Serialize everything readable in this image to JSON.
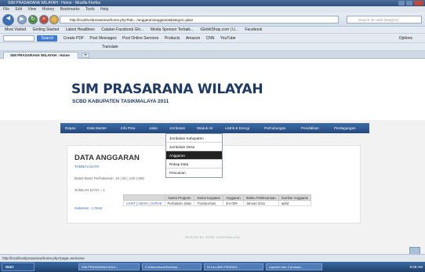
{
  "window": {
    "title": "SIM PRASARANA WILAYAH : Home - Mozilla Firefox"
  },
  "menubar": [
    "File",
    "Edit",
    "View",
    "History",
    "Bookmarks",
    "Tools",
    "Help"
  ],
  "navigation": {
    "url": "http://localhost/prasarana/home.php?hal=../anggaran/anggaran&kategori=jalan",
    "search_placeholder": "Search the web (Babylon)"
  },
  "bookmarks": [
    "Most Visited",
    "Getting Started",
    "Latest Headlines",
    "Catatan Facebook Glo...",
    "Media Sponsor Terbaik...",
    "iGlobitShop.com | U...",
    "Facebook"
  ],
  "toolbar2": {
    "search_button": "Search",
    "items": [
      "Create PDF",
      "Post Messages",
      "Post Online Services",
      "Products",
      "Amazon",
      "CNN",
      "YouTube"
    ],
    "options": "Options"
  },
  "toolbar3": {
    "translate": "Translate"
  },
  "tab": {
    "label": "SIM PRASARANA WILAYAH : Home",
    "new_tab": "+"
  },
  "site": {
    "title": "SIM PRASARANA WILAYAH",
    "subtitle": "SCBD KABUPATEN TASIKMALAYA 2011"
  },
  "nav_items": [
    "Depan",
    "Data Master",
    "Info Peta",
    "Jalan",
    "Jembatan",
    "Waduk Air",
    "Listrik & Energi",
    "Perhubungan",
    "Pendidikan",
    "Perdagangan"
  ],
  "dropdown": [
    "Jembatan Kabupaten",
    "Jembatan Desa",
    "Anggaran",
    "Rekap Data",
    "Pencarian"
  ],
  "panel": {
    "title": "DATA ANGGARAN",
    "add_link": "TAMBAH DATA",
    "rows_label": "Batas Baris Perhalaman: 10 | 50 | 100 | 500",
    "count_label": "JUMLAH DATA = 1",
    "paging": "Halaman : 1 Next"
  },
  "table": {
    "headers": [
      "",
      "Nama Program",
      "Nama Kegiatan",
      "Anggaran",
      "Waktu Pelaksanaan",
      "Sumber Anggaran"
    ],
    "rows": [
      [
        "LIHAT | UBAH | HAPUS",
        "Perbaikan Jalan",
        "Transportasi",
        "2m-009",
        "Januari 2011",
        "apbd"
      ]
    ]
  },
  "footer": "DESIGN BY SCBD TASIKMALAYA",
  "statusbar": "http://localhost/prasarana/home.php?page=welcome",
  "taskbar": {
    "start": "Start",
    "items": [
      "SIM PRASARANA WILA...",
      "C:\\Users\\Asus\\Desktop...",
      "Hi Lao ANH PRASAS...",
      "Laporan bab 3 prasara..."
    ],
    "clock": "8:48 AM"
  },
  "colors": {
    "nav_bar": "#2f5a94",
    "site_title": "#1e3a66",
    "dropdown_active": "#222222"
  }
}
